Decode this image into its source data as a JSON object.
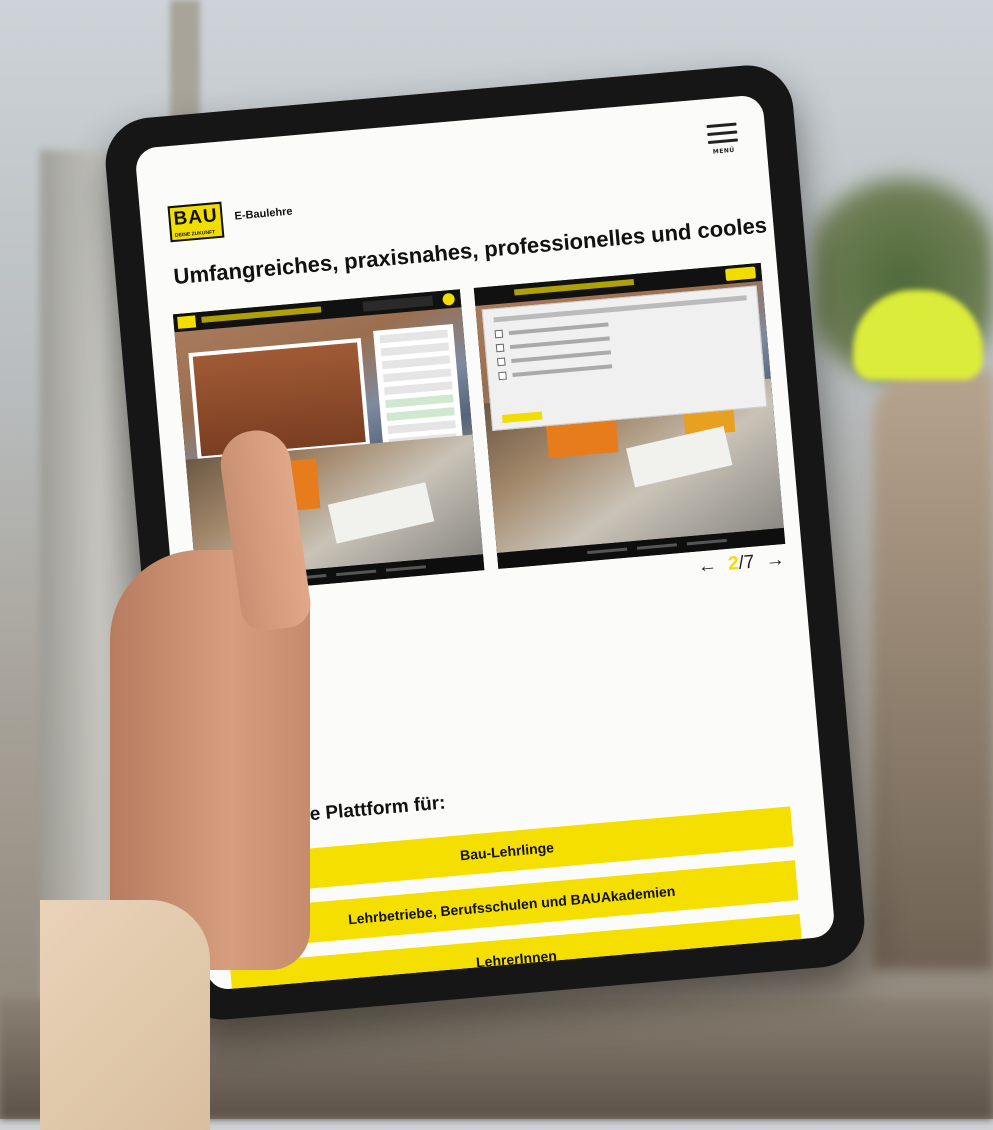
{
  "brand": {
    "logo_big": "BAU",
    "logo_small": "DEINE ZUKUNFT",
    "name": "E-Baulehre"
  },
  "menu": {
    "label": "MENÜ"
  },
  "headline": "Umfangreiches, praxisnahes, professionelles und cooles Lerntool",
  "carousel": {
    "current": "2",
    "separator": "/",
    "total": "7",
    "prev": "←",
    "next": "→",
    "dot_count": 6,
    "active_dot": 1
  },
  "platform": {
    "title": "Eine ideale Plattform für:",
    "items": [
      "Bau-Lehrlinge",
      "Lehrbetriebe, Berufsschulen und BAUAkademien",
      "LehrerInnen"
    ]
  },
  "colors": {
    "accent": "#f5df00",
    "text": "#111111",
    "screen": "#fbfbf9",
    "bezel": "#161616"
  }
}
